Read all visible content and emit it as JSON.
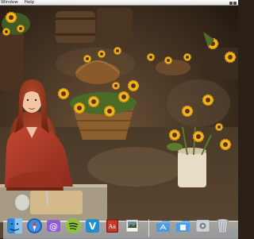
{
  "menubar": {
    "items": [
      {
        "label": "Window"
      },
      {
        "label": "Help"
      }
    ]
  },
  "desktop": {
    "wallpaper": "woman-with-sunflowers-photo"
  },
  "dock": {
    "apps": [
      {
        "icon": "finder-icon"
      },
      {
        "icon": "safari-icon"
      },
      {
        "icon": "mail-icon"
      },
      {
        "icon": "spotify-icon"
      },
      {
        "icon": "vine-icon"
      },
      {
        "icon": "dictionary-icon"
      },
      {
        "icon": "preview-icon"
      },
      {
        "icon": "applications-folder-icon"
      },
      {
        "icon": "documents-folder-icon"
      },
      {
        "icon": "system-preferences-icon"
      },
      {
        "icon": "trash-icon"
      }
    ]
  },
  "colors": {
    "menubar": "#eeeeee",
    "sweater": "#b23a2a",
    "sunflower": "#f2b51e"
  }
}
